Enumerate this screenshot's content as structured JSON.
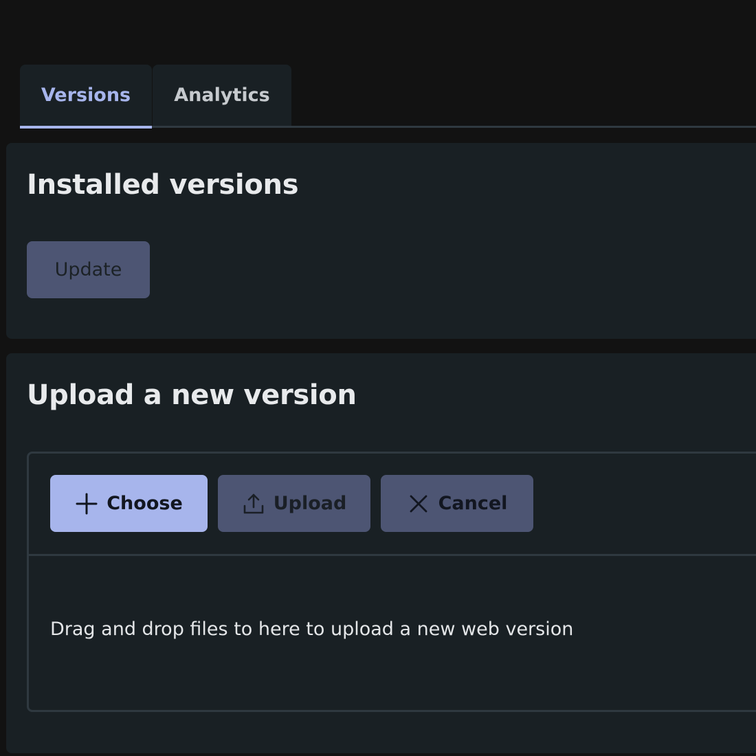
{
  "tabs": {
    "items": [
      {
        "label": "Versions",
        "active": true
      },
      {
        "label": "Analytics",
        "active": false
      }
    ],
    "active_color": "#a7b5ec"
  },
  "installed": {
    "title": "Installed versions",
    "update_label": "Update"
  },
  "upload": {
    "title": "Upload a new version",
    "choose_label": "Choose",
    "upload_label": "Upload",
    "cancel_label": "Cancel",
    "dropzone_text": "Drag and drop files to here to upload a new web version",
    "icons": {
      "choose": "plus-icon",
      "upload": "upload-icon",
      "cancel": "close-icon"
    }
  },
  "colors": {
    "background": "#121212",
    "surface": "#192024",
    "primary": "#a7b5ec",
    "secondary_button": "#4d5573"
  }
}
